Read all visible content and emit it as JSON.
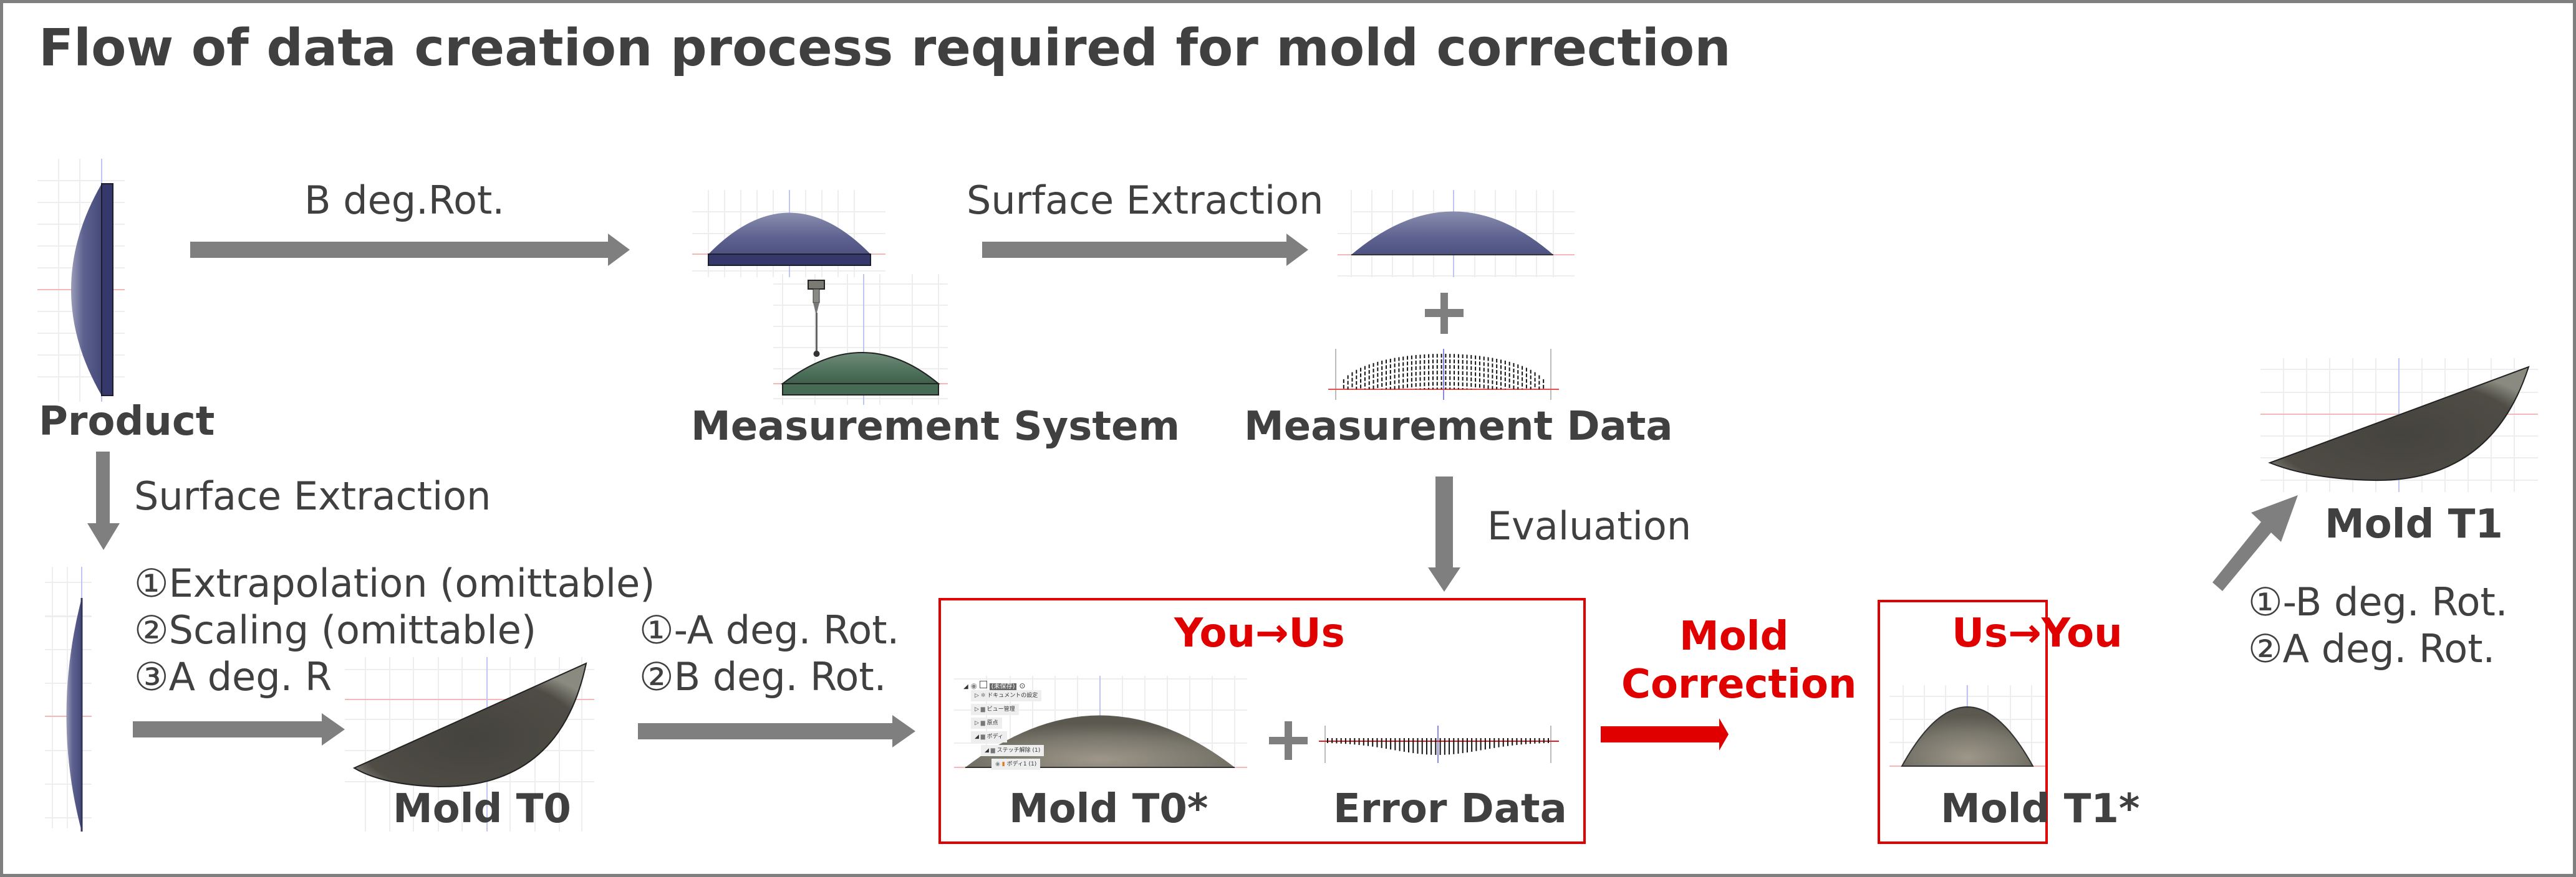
{
  "title": "Flow of data creation process required for mold correction",
  "nodes": {
    "product": "Product",
    "measurement_system": "Measurement System",
    "measurement_data": "Measurement Data",
    "mold_t0": "Mold T0",
    "mold_t0_star": "Mold T0*",
    "error_data": "Error Data",
    "mold_t1_star": "Mold T1*",
    "mold_t1": "Mold T1"
  },
  "arrows": {
    "b_rot": "B deg.Rot.",
    "surface_extraction_top": "Surface Extraction",
    "surface_extraction_left": "Surface Extraction",
    "evaluation": "Evaluation",
    "mold_correction_line1": "Mold",
    "mold_correction_line2": "Correction"
  },
  "steps": {
    "to_mold_t0": [
      "①Extrapolation (omittable)",
      "②Scaling (omittable)",
      "③A deg. R"
    ],
    "to_you_us": [
      "①-A deg. Rot.",
      "②B deg. Rot."
    ],
    "to_mold_t1": [
      "①-B deg. Rot.",
      "②A deg. Rot."
    ]
  },
  "boxes": {
    "you_to_us": "You→Us",
    "us_to_you": "Us→You"
  },
  "plus_signs": [
    "+",
    "+"
  ],
  "cad_tree": [
    {
      "label": "(未保存)",
      "indent": 0,
      "icon": "component-icon"
    },
    {
      "label": "ドキュメントの設定",
      "indent": 1,
      "icon": "gear-icon"
    },
    {
      "label": "ビュー管理",
      "indent": 1,
      "icon": "folder-icon"
    },
    {
      "label": "原点",
      "indent": 1,
      "icon": "folder-icon"
    },
    {
      "label": "ボディ",
      "indent": 1,
      "icon": "folder-icon"
    },
    {
      "label": "ステッチ解除 (1)",
      "indent": 2,
      "icon": "folder-icon"
    },
    {
      "label": "ボディ1 (1)",
      "indent": 3,
      "icon": "body-icon"
    }
  ],
  "colors": {
    "text": "#404040",
    "arrow_gray": "#7f7f7f",
    "accent_red": "#e00000",
    "product_blue": "#4d5280",
    "probe_green": "#4a6e58",
    "mold_gray": "#5a5850"
  }
}
